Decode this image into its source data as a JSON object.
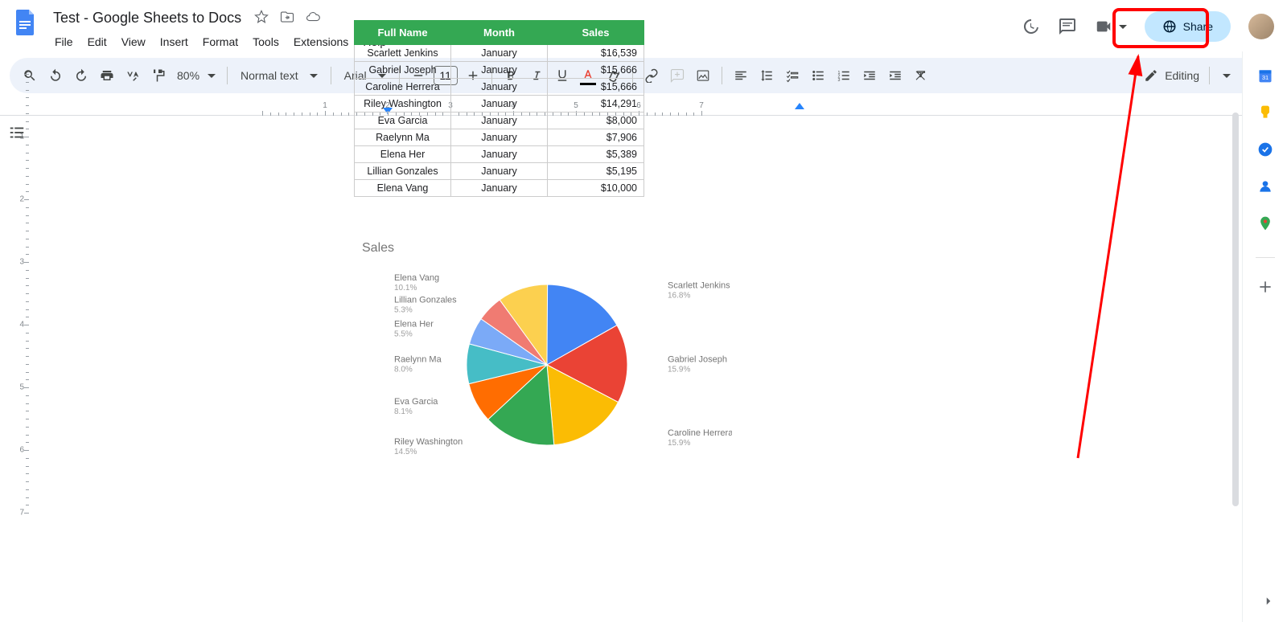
{
  "doc_title": "Test - Google Sheets to Docs",
  "menus": [
    "File",
    "Edit",
    "View",
    "Insert",
    "Format",
    "Tools",
    "Extensions",
    "Help"
  ],
  "zoom": "80%",
  "style_name": "Normal text",
  "font_name": "Arial",
  "font_size": "11",
  "editing_label": "Editing",
  "share_label": "Share",
  "table": {
    "headers": [
      "Full Name",
      "Month",
      "Sales"
    ],
    "rows": [
      {
        "name": "Scarlett Jenkins",
        "month": "January",
        "sales": "$16,539"
      },
      {
        "name": "Gabriel Joseph",
        "month": "January",
        "sales": "$15,666"
      },
      {
        "name": "Caroline Herrera",
        "month": "January",
        "sales": "$15,666"
      },
      {
        "name": "Riley Washington",
        "month": "January",
        "sales": "$14,291"
      },
      {
        "name": "Eva Garcia",
        "month": "January",
        "sales": "$8,000"
      },
      {
        "name": "Raelynn Ma",
        "month": "January",
        "sales": "$7,906"
      },
      {
        "name": "Elena Her",
        "month": "January",
        "sales": "$5,389"
      },
      {
        "name": "Lillian Gonzales",
        "month": "January",
        "sales": "$5,195"
      },
      {
        "name": "Elena Vang",
        "month": "January",
        "sales": "$10,000"
      }
    ]
  },
  "chart_data": {
    "type": "pie",
    "title": "Sales",
    "series": [
      {
        "name": "Scarlett Jenkins",
        "pct": 16.8,
        "color": "#4285f4"
      },
      {
        "name": "Gabriel Joseph",
        "pct": 15.9,
        "color": "#ea4335"
      },
      {
        "name": "Caroline Herrera",
        "pct": 15.9,
        "color": "#fbbc04"
      },
      {
        "name": "Riley Washington",
        "pct": 14.5,
        "color": "#34a853"
      },
      {
        "name": "Eva Garcia",
        "pct": 8.1,
        "color": "#ff6d01"
      },
      {
        "name": "Raelynn Ma",
        "pct": 8.0,
        "color": "#46bdc6"
      },
      {
        "name": "Elena Her",
        "pct": 5.5,
        "color": "#7baaf7"
      },
      {
        "name": "Lillian Gonzales",
        "pct": 5.3,
        "color": "#f07b72"
      },
      {
        "name": "Elena Vang",
        "pct": 10.1,
        "color": "#fcd04f"
      }
    ]
  },
  "ruler_numbers": [
    1,
    2,
    3,
    4,
    5,
    6,
    7
  ],
  "vruler_numbers": [
    1,
    2,
    3,
    4,
    5,
    6,
    7
  ]
}
